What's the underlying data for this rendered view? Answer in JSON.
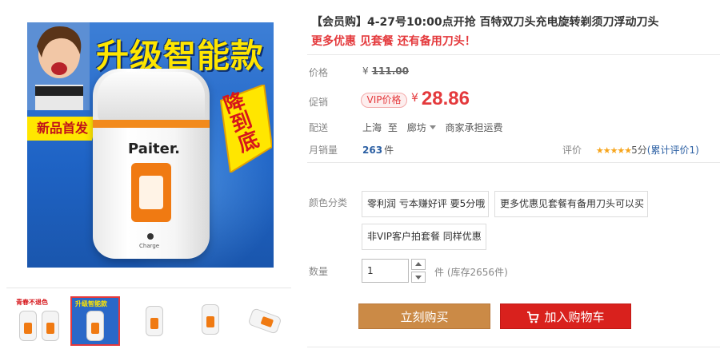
{
  "gallery": {
    "main_image": {
      "headline": "升级智能款",
      "badge_new": "新品首发",
      "burst_text": "降到底",
      "brand": "Paiter.",
      "charge_label": "Charge"
    },
    "thumbnails": [
      {
        "caption": "青春不退色"
      },
      {
        "caption": "升级智能款"
      },
      {
        "caption": ""
      },
      {
        "caption": ""
      },
      {
        "caption": ""
      }
    ]
  },
  "product": {
    "title": "【会员购】4-27号10:00点开抢 百特双刀头充电旋转剃须刀浮动刀头",
    "subtitle": "更多优惠 见套餐 还有备用刀头！"
  },
  "price": {
    "label": "价格",
    "currency": "¥",
    "original": "111.00",
    "promo_label": "促销",
    "vip_badge": "VIP价格",
    "promo_currency": "¥",
    "promo_value": "28.86"
  },
  "shipping": {
    "label": "配送",
    "from": "上海",
    "to_word": "至",
    "destination": "廊坊",
    "note": "商家承担运费"
  },
  "sales": {
    "label": "月销量",
    "count": "263",
    "unit": "件",
    "rating_label": "评价",
    "stars": "★★★★★",
    "score": "5分",
    "review_count": "(累计评价1)"
  },
  "options": {
    "label": "颜色分类",
    "items": [
      "零利润 亏本赚好评 要5分哦",
      "更多优惠见套餐有备用刀头可以买",
      "非VIP客户拍套餐 同样优惠"
    ]
  },
  "quantity": {
    "label": "数量",
    "value": "1",
    "unit": "件",
    "stock": "(库存2656件)"
  },
  "actions": {
    "buy_now": "立刻购买",
    "add_to_cart": "加入购物车"
  },
  "colors": {
    "accent_red": "#e4393c",
    "buy_button": "#cb8a46",
    "cart_button": "#d9211d",
    "link_blue": "#2b5fa3"
  }
}
